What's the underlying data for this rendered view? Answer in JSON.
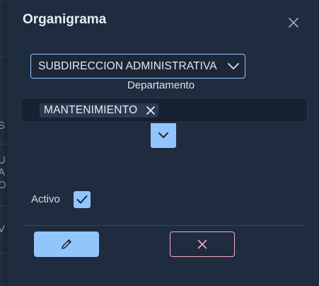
{
  "dialog": {
    "title": "Organigrama",
    "close_icon": "close-icon"
  },
  "background": {
    "clipped_text": [
      "S",
      "U",
      "A",
      "O",
      "V"
    ]
  },
  "select": {
    "value": "SUBDIRECCION ADMINISTRATIVA",
    "icon": "chevron-down-icon"
  },
  "departamento": {
    "label": "Departamento",
    "chips": [
      {
        "label": "MANTENIMIENTO",
        "remove_icon": "close-icon"
      }
    ],
    "dropdown_icon": "chevron-down-icon"
  },
  "activo": {
    "label": "Activo",
    "checked": true
  },
  "buttons": {
    "edit_icon": "pencil-icon",
    "cancel_icon": "close-icon"
  },
  "colors": {
    "accent": "#93c5fd",
    "danger": "#f9a8c4",
    "dialog_bg": "#1f2b3e"
  }
}
